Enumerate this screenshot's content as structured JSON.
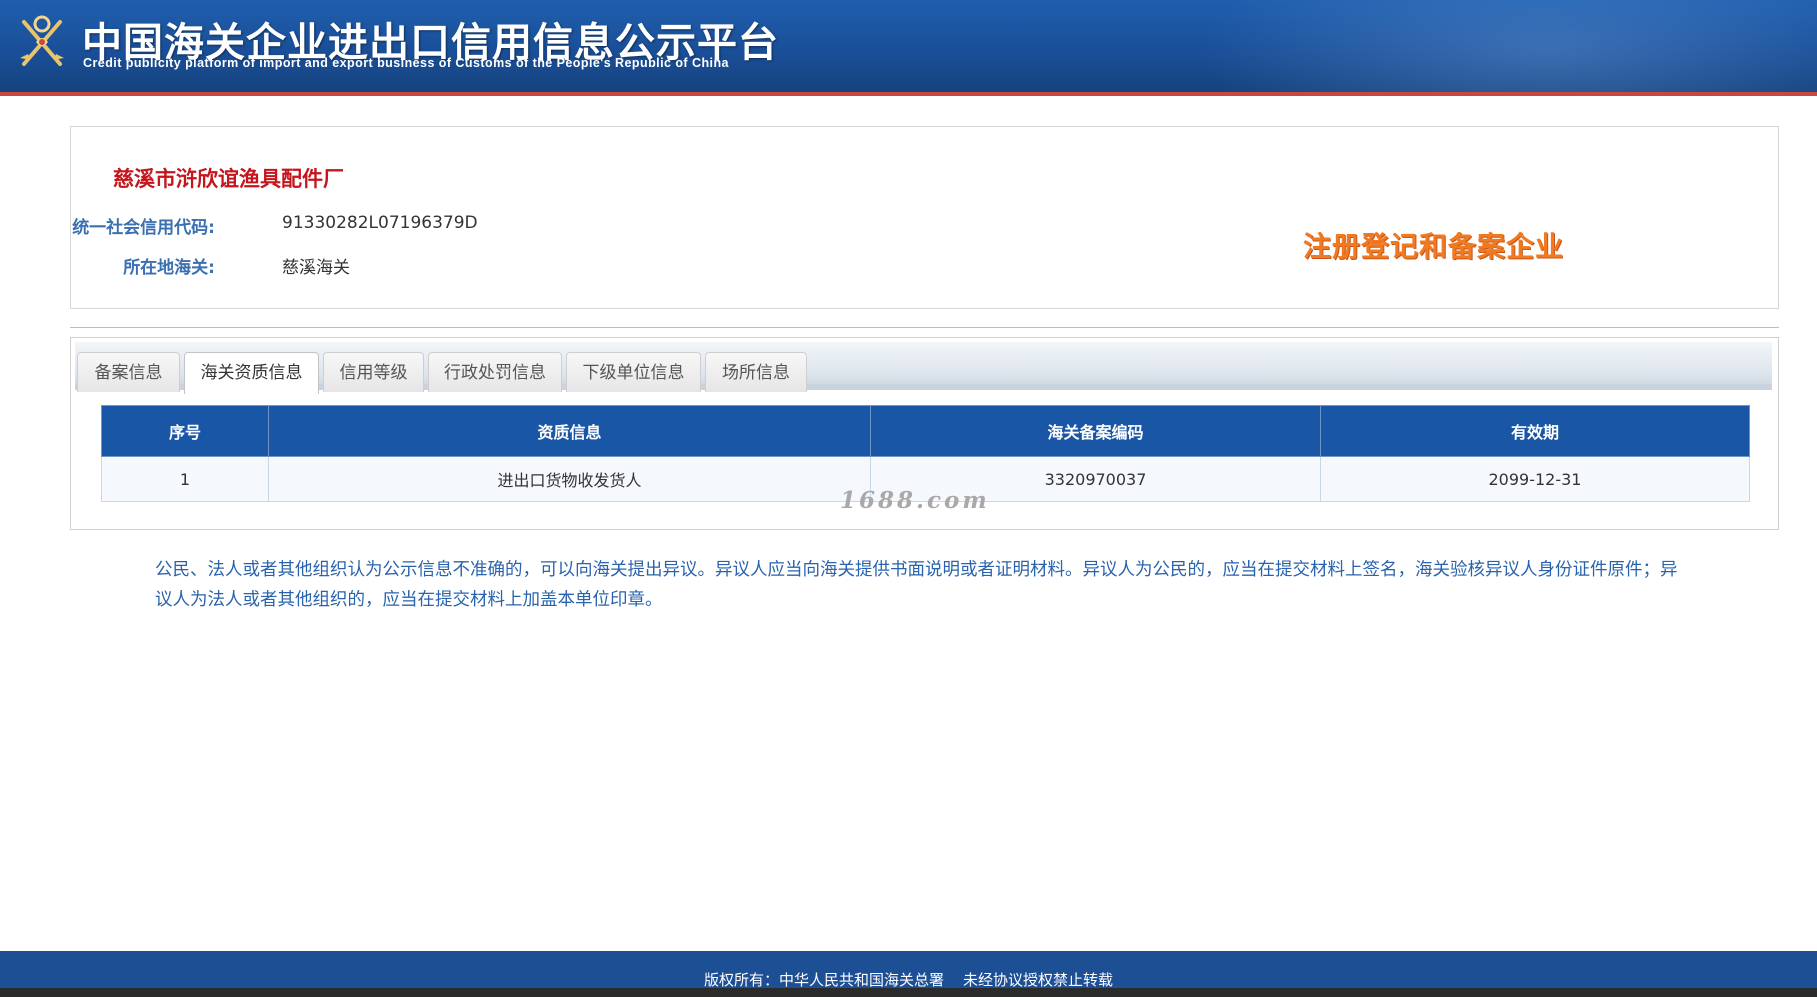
{
  "header": {
    "title_cn": "中国海关企业进出口信用信息公示平台",
    "title_en": "Credit publicity platform of import and export business of Customs of the People's Republic of China",
    "logo_icon": "customs-emblem-icon"
  },
  "company": {
    "name": "慈溪市浒欣谊渔具配件厂",
    "credit_code_label": "统一社会信用代码:",
    "credit_code": "91330282L07196379D",
    "customs_label": "所在地海关:",
    "customs": "慈溪海关",
    "status_badge": "注册登记和备案企业"
  },
  "tabs": [
    {
      "label": "备案信息"
    },
    {
      "label": "海关资质信息"
    },
    {
      "label": "信用等级"
    },
    {
      "label": "行政处罚信息"
    },
    {
      "label": "下级单位信息"
    },
    {
      "label": "场所信息"
    }
  ],
  "active_tab": "海关资质信息",
  "table": {
    "headers": [
      "序号",
      "资质信息",
      "海关备案编码",
      "有效期"
    ],
    "rows": [
      [
        "1",
        "进出口货物收发货人",
        "3320970037",
        "2099-12-31"
      ]
    ]
  },
  "watermark": "1688.com",
  "notice": "公民、法人或者其他组织认为公示信息不准确的，可以向海关提出异议。异议人应当向海关提供书面说明或者证明材料。异议人为公民的，应当在提交材料上签名，海关验核异议人身份证件原件；异议人为法人或者其他组织的，应当在提交材料上加盖本单位印章。",
  "footer": {
    "copyright": "版权所有：中华人民共和国海关总署    未经协议授权禁止转载"
  },
  "colors": {
    "header_blue": "#1a4f98",
    "header_red_line": "#c8473e",
    "company_name_red": "#c4161c",
    "label_blue": "#3a6fb0",
    "badge_orange": "#f07a22",
    "table_header_blue": "#1a56a6",
    "notice_blue": "#2a63ad",
    "footer_blue": "#1d4f95"
  }
}
